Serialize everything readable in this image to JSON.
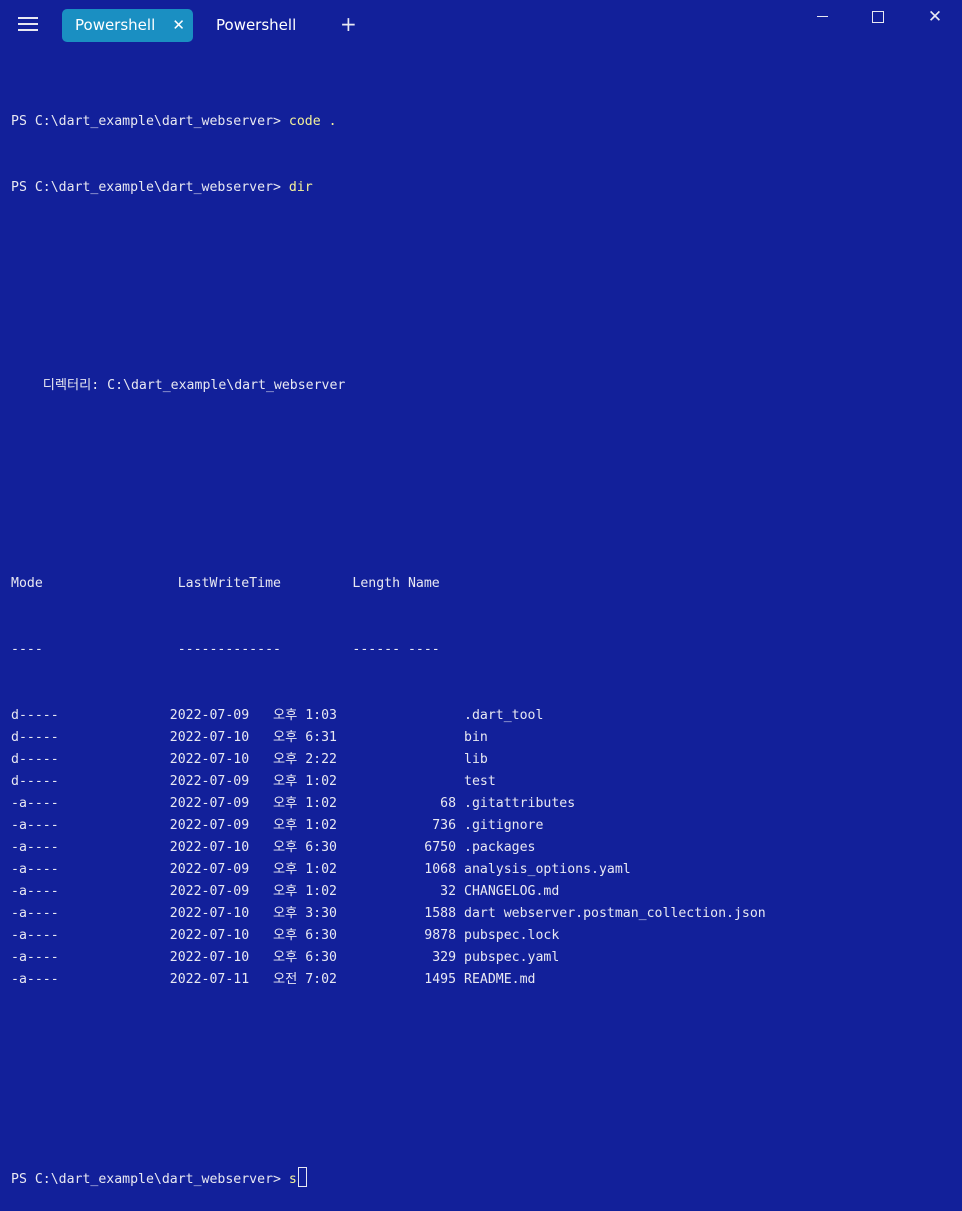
{
  "window": {
    "tabs": [
      {
        "label": "Powershell",
        "active": true,
        "close_glyph": "✕"
      },
      {
        "label": "Powershell",
        "active": false
      }
    ],
    "new_tab_glyph": "+",
    "close_glyph": "✕"
  },
  "terminal": {
    "prompt": "PS C:\\dart_example\\dart_webserver> ",
    "history": [
      {
        "command": "code ."
      },
      {
        "command": "dir"
      }
    ],
    "directory_header": "    디렉터리: C:\\dart_example\\dart_webserver",
    "columns": {
      "header": "Mode                 LastWriteTime         Length Name",
      "underline": "----                 -------------         ------ ----"
    },
    "entries": [
      {
        "mode": "d-----",
        "date": "2022-07-09",
        "ampm": "오후",
        "time": "1:03",
        "length": "",
        "name": ".dart_tool"
      },
      {
        "mode": "d-----",
        "date": "2022-07-10",
        "ampm": "오후",
        "time": "6:31",
        "length": "",
        "name": "bin"
      },
      {
        "mode": "d-----",
        "date": "2022-07-10",
        "ampm": "오후",
        "time": "2:22",
        "length": "",
        "name": "lib"
      },
      {
        "mode": "d-----",
        "date": "2022-07-09",
        "ampm": "오후",
        "time": "1:02",
        "length": "",
        "name": "test"
      },
      {
        "mode": "-a----",
        "date": "2022-07-09",
        "ampm": "오후",
        "time": "1:02",
        "length": "68",
        "name": ".gitattributes"
      },
      {
        "mode": "-a----",
        "date": "2022-07-09",
        "ampm": "오후",
        "time": "1:02",
        "length": "736",
        "name": ".gitignore"
      },
      {
        "mode": "-a----",
        "date": "2022-07-10",
        "ampm": "오후",
        "time": "6:30",
        "length": "6750",
        "name": ".packages"
      },
      {
        "mode": "-a----",
        "date": "2022-07-09",
        "ampm": "오후",
        "time": "1:02",
        "length": "1068",
        "name": "analysis_options.yaml"
      },
      {
        "mode": "-a----",
        "date": "2022-07-09",
        "ampm": "오후",
        "time": "1:02",
        "length": "32",
        "name": "CHANGELOG.md"
      },
      {
        "mode": "-a----",
        "date": "2022-07-10",
        "ampm": "오후",
        "time": "3:30",
        "length": "1588",
        "name": "dart webserver.postman_collection.json"
      },
      {
        "mode": "-a----",
        "date": "2022-07-10",
        "ampm": "오후",
        "time": "6:30",
        "length": "9878",
        "name": "pubspec.lock"
      },
      {
        "mode": "-a----",
        "date": "2022-07-10",
        "ampm": "오후",
        "time": "6:30",
        "length": "329",
        "name": "pubspec.yaml"
      },
      {
        "mode": "-a----",
        "date": "2022-07-11",
        "ampm": "오전",
        "time": "7:02",
        "length": "1495",
        "name": "README.md"
      }
    ],
    "current_input": "s"
  },
  "colors": {
    "background": "#12209a",
    "active_tab": "#1a8fc2",
    "command_text": "#f5f29a",
    "text": "#e8e8f2"
  }
}
